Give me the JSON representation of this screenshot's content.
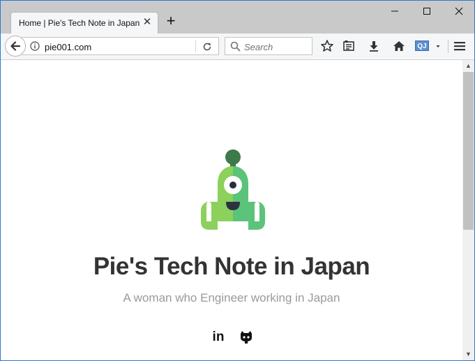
{
  "browser": {
    "tab": {
      "title": "Home | Pie's Tech Note in Japan",
      "close_glyph": "✕"
    },
    "new_tab_glyph": "+",
    "window_controls": {
      "minimize": "—",
      "maximize": "☐",
      "close": "✕"
    },
    "url": "pie001.com",
    "search_placeholder": "Search",
    "extension_badge": "QJ",
    "accent_color": "#2b79d0"
  },
  "page": {
    "title": "Pie's Tech Note in Japan",
    "tagline": "A woman who Engineer working in Japan",
    "social": {
      "linkedin": "in",
      "github": "github-icon"
    },
    "mascot": {
      "body_light": "#8bd15b",
      "body_dark": "#5cc37a",
      "antenna": "#3d7a4a"
    }
  },
  "scrollbar": {
    "up": "▲",
    "down": "▼",
    "position": 0
  }
}
